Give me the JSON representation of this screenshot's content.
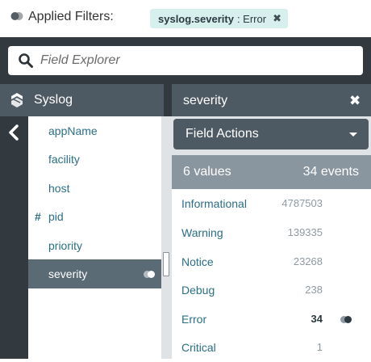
{
  "filter_bar": {
    "label": "Applied Filters:",
    "chip": {
      "field": "syslog.severity",
      "value": ": Error",
      "remove_icon": "✖"
    }
  },
  "search": {
    "placeholder": "Field Explorer",
    "value": ""
  },
  "source": {
    "label": "Syslog"
  },
  "fields": [
    {
      "name": "appName",
      "numeric": false
    },
    {
      "name": "facility",
      "numeric": false
    },
    {
      "name": "host",
      "numeric": false
    },
    {
      "name": "pid",
      "numeric": true,
      "type_glyph": "#"
    },
    {
      "name": "priority",
      "numeric": false
    },
    {
      "name": "severity",
      "numeric": false,
      "selected": true
    }
  ],
  "detail": {
    "title": "severity",
    "close_glyph": "✖",
    "actions_label": "Field Actions",
    "summary_values": "6 values",
    "summary_events": "34 events",
    "values": [
      {
        "name": "Informational",
        "count": "4787503"
      },
      {
        "name": "Warning",
        "count": "139335"
      },
      {
        "name": "Notice",
        "count": "23268"
      },
      {
        "name": "Debug",
        "count": "238"
      },
      {
        "name": "Error",
        "count": "34",
        "active": true
      },
      {
        "name": "Critical",
        "count": "1"
      }
    ]
  },
  "colors": {
    "chip_bg": "#d7f0ee",
    "panel_dark": "#32393f",
    "header_bg": "#4e5a63",
    "selected_row": "#5b6b76",
    "link": "#2a6f86",
    "summary_bg": "#8a969f"
  },
  "icons": {
    "filter": "filter-toggle-icon",
    "search": "search-icon",
    "source": "syslog-icon",
    "back": "chevron-left-icon",
    "filtered": "filter-toggle-icon"
  }
}
